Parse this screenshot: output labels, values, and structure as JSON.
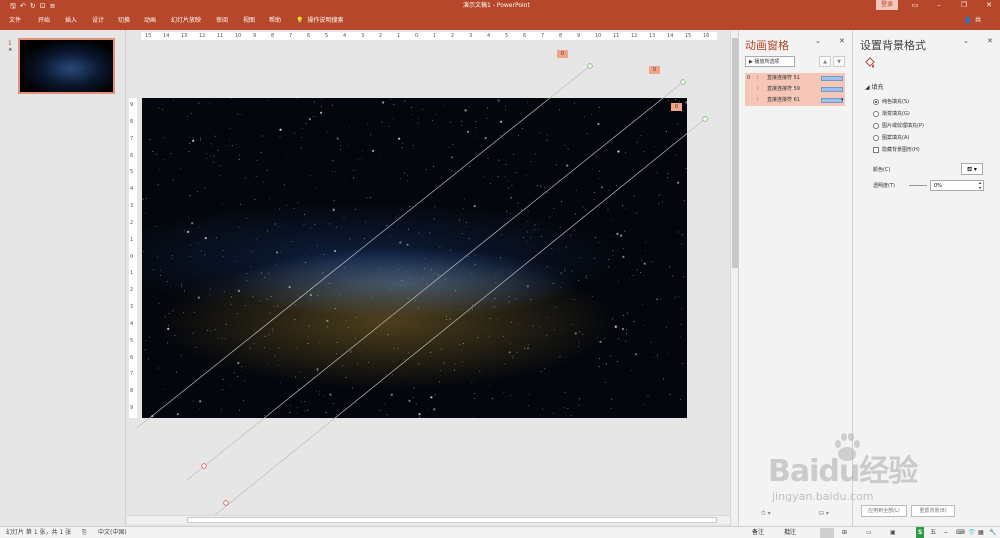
{
  "titlebar": {
    "doc_title": "演示文稿1  -  PowerPoint",
    "login": "登录",
    "qat_icons": [
      "save-icon",
      "undo-icon",
      "redo-icon",
      "start-from-beginning-icon",
      "customize-icon"
    ],
    "window_controls": [
      "ribbon-display-icon",
      "minimize-icon",
      "restore-icon",
      "close-icon"
    ]
  },
  "ribbon": {
    "tabs": [
      "文件",
      "开始",
      "插入",
      "设计",
      "切换",
      "动画",
      "幻灯片放映",
      "审阅",
      "视图",
      "帮助"
    ],
    "tell_me": "操作说明搜索",
    "share": "共享"
  },
  "slides_pane": {
    "slide_number": "1",
    "slide_marker": "★"
  },
  "ruler": {
    "h_ticks": [
      "15",
      "14",
      "13",
      "12",
      "11",
      "10",
      "9",
      "8",
      "7",
      "6",
      "5",
      "4",
      "3",
      "2",
      "1",
      "0",
      "1",
      "2",
      "3",
      "4",
      "5",
      "6",
      "7",
      "8",
      "9",
      "10",
      "11",
      "12",
      "13",
      "14",
      "15",
      "16"
    ],
    "v_ticks": [
      "9",
      "8",
      "7",
      "6",
      "5",
      "4",
      "3",
      "2",
      "1",
      "0",
      "1",
      "2",
      "3",
      "4",
      "5",
      "6",
      "7",
      "8",
      "9"
    ]
  },
  "editor": {
    "anim_tags": [
      "0",
      "0",
      "0"
    ]
  },
  "animation_pane": {
    "title": "动画窗格",
    "play_all": "播放所选项",
    "items": [
      {
        "index": "0",
        "label": "直接连接符 51"
      },
      {
        "index": "",
        "label": "直接连接符 59"
      },
      {
        "index": "",
        "label": "直接连接符 61"
      }
    ]
  },
  "format_background": {
    "title": "设置背景格式",
    "section": "填充",
    "options": [
      {
        "label": "纯色填充(S)",
        "type": "radio",
        "checked": true
      },
      {
        "label": "渐变填充(G)",
        "type": "radio",
        "checked": false
      },
      {
        "label": "图片或纹理填充(P)",
        "type": "radio",
        "checked": false
      },
      {
        "label": "图案填充(A)",
        "type": "radio",
        "checked": false
      },
      {
        "label": "隐藏背景图形(H)",
        "type": "checkbox",
        "checked": false
      }
    ],
    "color_label": "颜色(C)",
    "transparency_label": "透明度(T)",
    "transparency_value": "0%",
    "footer_left": "应用到全部(L)",
    "footer_right": "重置背景(B)"
  },
  "statusbar": {
    "slide_info": "幻灯片 第 1 张，共 1 张",
    "language": "中文(中国)",
    "notes": "备注",
    "comments": "批注"
  },
  "watermark": {
    "main": "Baidu经验",
    "sub": "jingyan.baidu.com"
  },
  "colors": {
    "accent": "#b7472a",
    "tag": "#f0a48a",
    "selected_row": "#f6c7b6"
  }
}
